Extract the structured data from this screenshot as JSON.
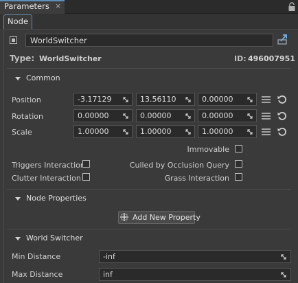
{
  "panel": {
    "title": "Parameters",
    "close": "×"
  },
  "tabs": {
    "node": "Node"
  },
  "node": {
    "name": "WorldSwitcher",
    "type_label": "Type:",
    "type_value": "WorldSwitcher",
    "id_label": "ID:",
    "id_value": "496007951"
  },
  "common": {
    "title": "Common",
    "rows": [
      {
        "label": "Position",
        "x": "-3.17129",
        "y": "13.56110",
        "z": "0.00000"
      },
      {
        "label": "Rotation",
        "x": "0.00000",
        "y": "0.00000",
        "z": "0.00000"
      },
      {
        "label": "Scale",
        "x": "1.00000",
        "y": "1.00000",
        "z": "1.00000"
      }
    ],
    "immovable": "Immovable",
    "triggers": "Triggers Interaction",
    "culled": "Culled by Occlusion Query",
    "clutter": "Clutter Interaction",
    "grass": "Grass Interaction"
  },
  "node_properties": {
    "title": "Node Properties",
    "add_button": "Add New Property"
  },
  "world_switcher": {
    "title": "World Switcher",
    "min_label": "Min Distance",
    "min_value": "-inf",
    "max_label": "Max Distance",
    "max_value": "inf"
  }
}
